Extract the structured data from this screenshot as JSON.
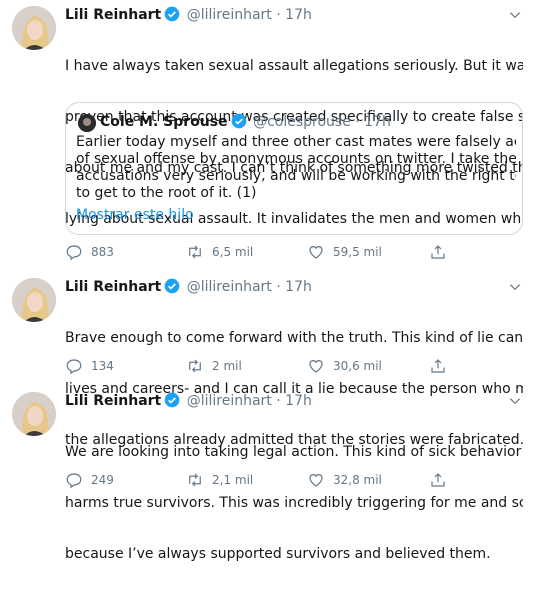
{
  "tweets": [
    {
      "name": "Lili Reinhart",
      "handle": "@lilireinhart",
      "sep": "·",
      "time": "17h",
      "lines": [
        "I have always taken sexual assault allegations seriously. But it was",
        "proven that this account was created specifically to create false stories",
        "about me and my cast.  I can’t think of something more twisted than",
        "lying about sexual assault. It invalidates the men and women who are-"
      ],
      "quote": {
        "name": "Cole M. Sprouse",
        "handle": "@colesprouse",
        "sep": "·",
        "time": "17h",
        "lines": [
          "Earlier today myself and three other cast mates were falsely accused",
          "of sexual offense by anonymous accounts on twitter. I take these",
          "accusations very seriously, and will be working with the right teams",
          "to get to the root of it. (1)"
        ],
        "link": "Mostrar este hilo"
      },
      "replies": "883",
      "retweets": "6,5 mil",
      "likes": "59,5 mil"
    },
    {
      "name": "Lili Reinhart",
      "handle": "@lilireinhart",
      "sep": "·",
      "time": "17h",
      "lines": [
        "Brave enough to come forward with the truth. This kind of lie can ruin",
        "lives and careers- and I can call it a lie because the person who made",
        "the allegations already admitted that the stories were fabricated."
      ],
      "replies": "134",
      "retweets": "2 mil",
      "likes": "30,6 mil"
    },
    {
      "name": "Lili Reinhart",
      "handle": "@lilireinhart",
      "sep": "·",
      "time": "17h",
      "lines": [
        "We are looking into taking legal action. This kind of sick behavior only",
        "harms true survivors. This was incredibly triggering for me and scary",
        "because I’ve always supported survivors and believed them."
      ],
      "replies": "249",
      "retweets": "2,1 mil",
      "likes": "32,8 mil"
    }
  ],
  "colors": {
    "accent": "#1da1f2",
    "link": "#1b95e0",
    "secondary": "#657786",
    "border": "#ccd6dd"
  },
  "icons": [
    "verified-badge-icon",
    "chevron-down-icon",
    "reply-icon",
    "retweet-icon",
    "like-icon",
    "share-icon"
  ]
}
